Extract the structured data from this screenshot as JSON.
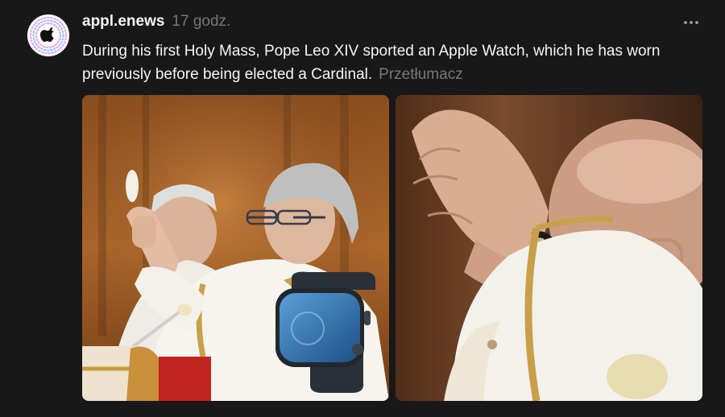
{
  "post": {
    "username": "appl.enews",
    "timestamp": "17 godz.",
    "caption": "During his first Holy Mass, Pope Leo XIV sported an Apple Watch, which he has worn previously before being elected a Cardinal.",
    "translate_label": "Przetłumacz",
    "avatar_icon": "apple-logo-icon",
    "more_icon": "more-options-icon"
  },
  "media": [
    {
      "kind": "photo",
      "description_icon": "photo"
    },
    {
      "kind": "photo",
      "description_icon": "photo"
    }
  ],
  "colors": {
    "background": "#181818",
    "text_primary": "#f3f5f7",
    "text_secondary": "#777777"
  }
}
